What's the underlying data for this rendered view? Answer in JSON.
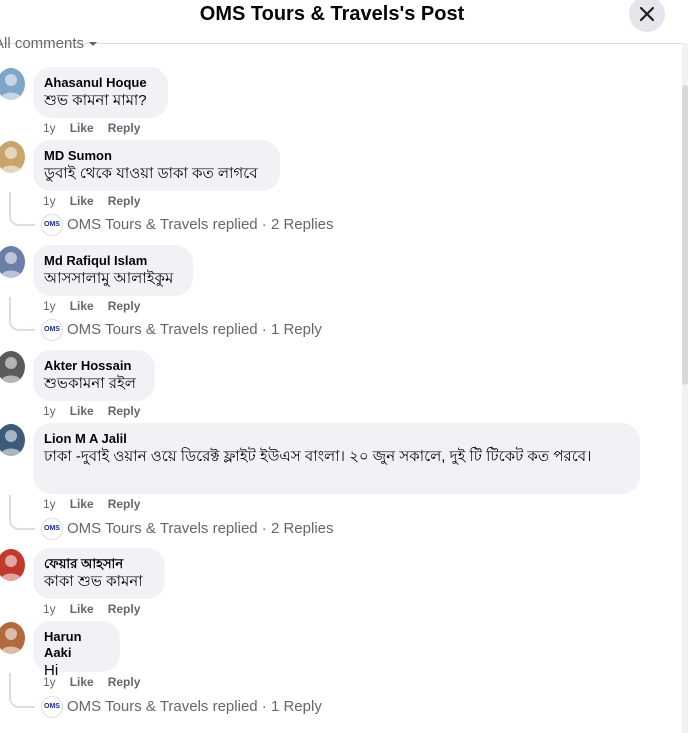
{
  "header": {
    "title": "OMS Tours & Travels's Post"
  },
  "filter": {
    "label": "All comments"
  },
  "reply_logo_text": "OMS",
  "comments": [
    {
      "author": "Ahasanul Hoque",
      "text": "শুভ কামনা মামা?",
      "time": "1y",
      "like": "Like",
      "reply": "Reply",
      "replies": "",
      "avatar_color": "#7fa6c9"
    },
    {
      "author": "MD Sumon",
      "text": "ডুবাই থেকে যাওয়া ডাকা কত লাগবে",
      "time": "1y",
      "like": "Like",
      "reply": "Reply",
      "replies": "OMS Tours & Travels replied · 2 Replies",
      "avatar_color": "#c9a56b"
    },
    {
      "author": "Md Rafiqul Islam",
      "text": "আসসালামু আলাইকুম",
      "time": "1y",
      "like": "Like",
      "reply": "Reply",
      "replies": "OMS Tours & Travels replied · 1 Reply",
      "avatar_color": "#6b7ea8"
    },
    {
      "author": "Akter Hossain",
      "text": "শুভকামনা রইল",
      "time": "1y",
      "like": "Like",
      "reply": "Reply",
      "replies": "",
      "avatar_color": "#5a5a5a"
    },
    {
      "author": "Lion M A Jalil",
      "text": "ঢাকা -দুবাই ওয়ান ওয়ে ডিরেক্ট ফ্লাইট ইউএস বাংলা। ২০ জুন সকালে, দুই টি টিকেট কত পরবে।",
      "time": "1y",
      "like": "Like",
      "reply": "Reply",
      "replies": "OMS Tours & Travels replied · 2 Replies",
      "avatar_color": "#3c5a7a"
    },
    {
      "author": "ফেয়ার আহসান",
      "text": "কাকা শুভ কামনা",
      "time": "1y",
      "like": "Like",
      "reply": "Reply",
      "replies": "",
      "avatar_color": "#c0392b"
    },
    {
      "author": "Harun Aaki",
      "text": "Hi",
      "time": "1y",
      "like": "Like",
      "reply": "Reply",
      "replies": "OMS Tours & Travels replied · 1 Reply",
      "avatar_color": "#b06a3b"
    }
  ]
}
